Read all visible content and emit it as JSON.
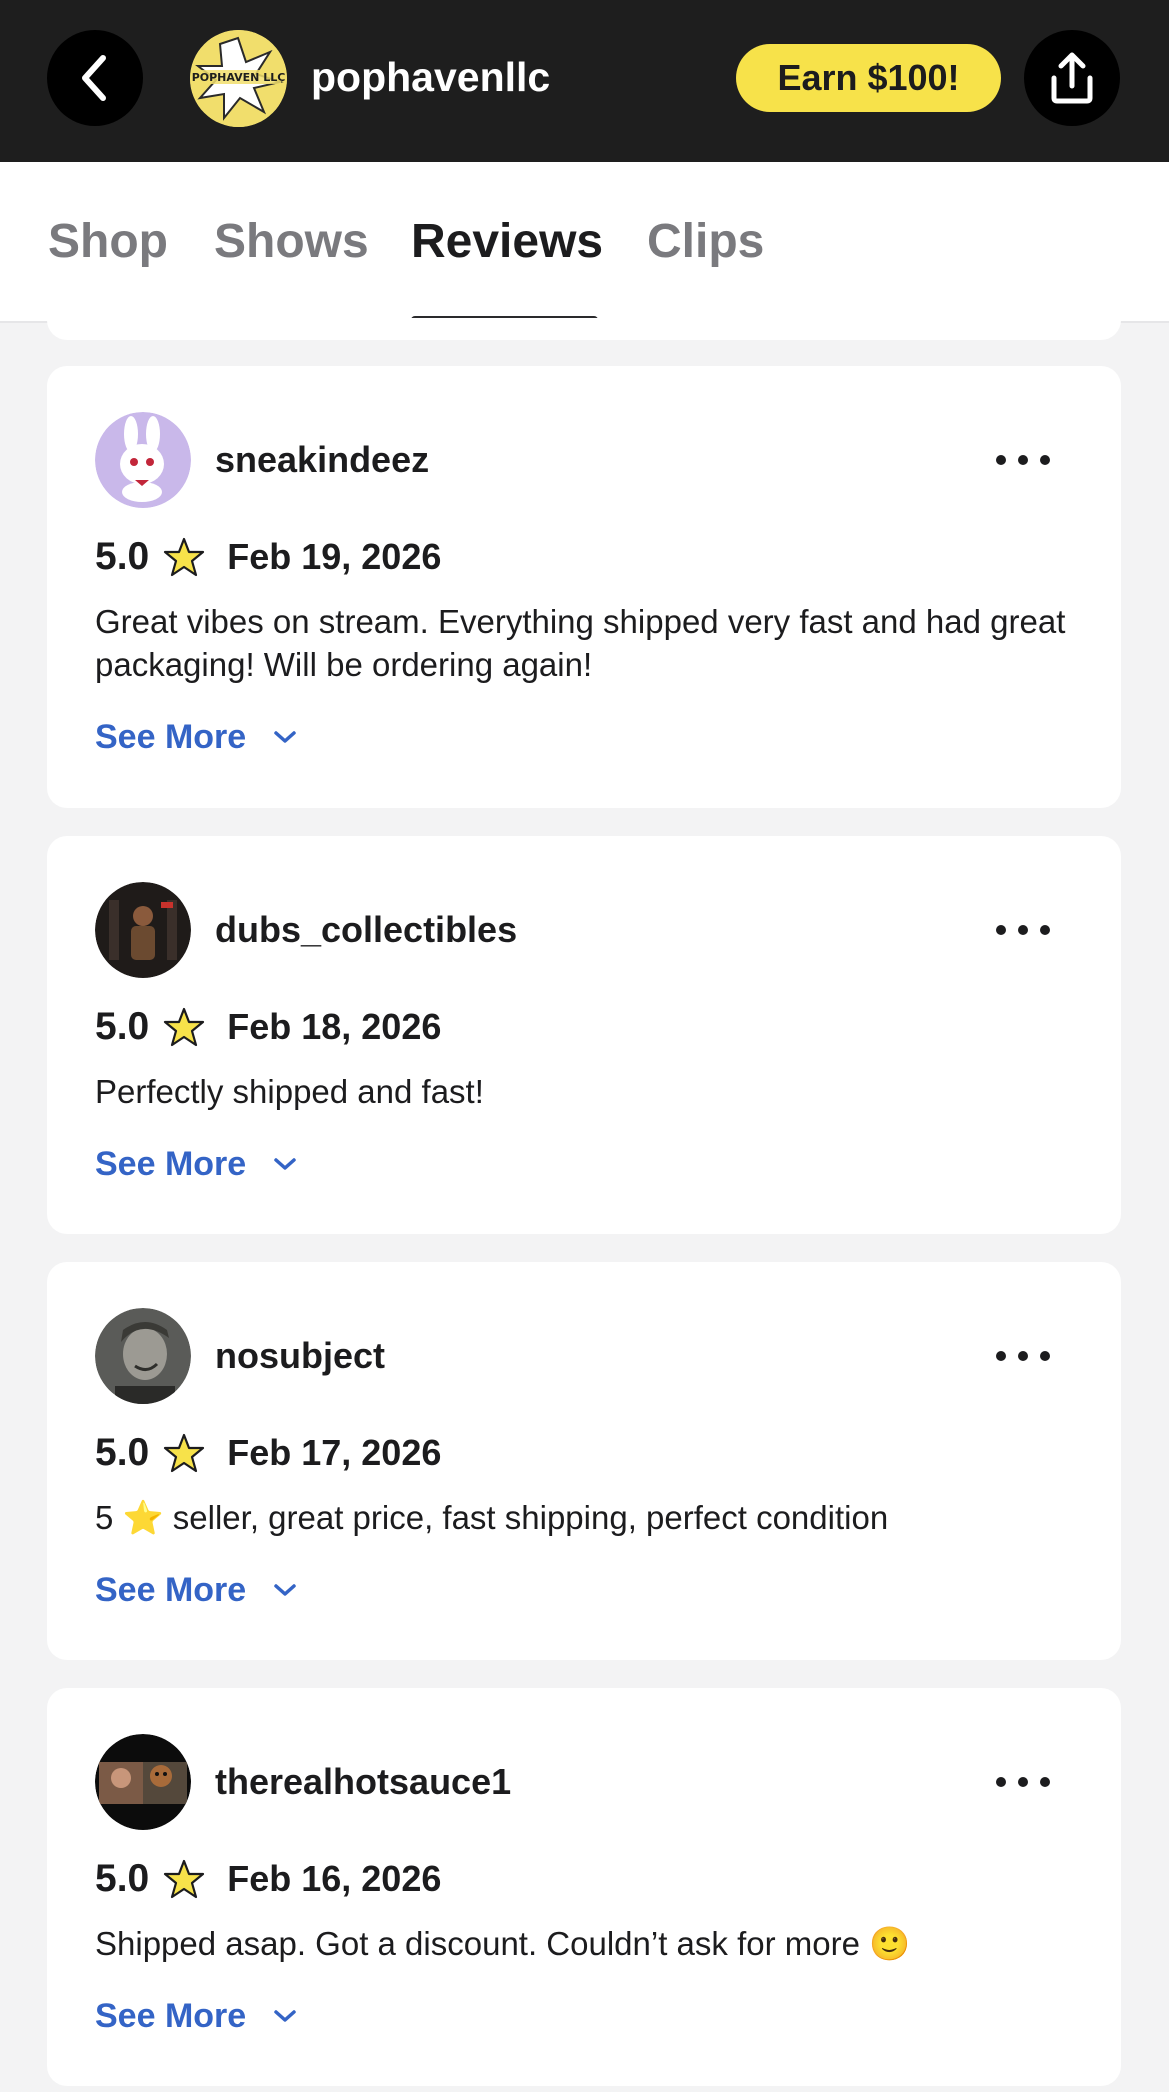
{
  "header": {
    "shop_name": "pophavenllc",
    "avatar_logo_text": "POPHAVEN LLC",
    "earn_label": "Earn $100!"
  },
  "tabs": [
    {
      "label": "Shop",
      "active": false
    },
    {
      "label": "Shows",
      "active": false
    },
    {
      "label": "Reviews",
      "active": true
    },
    {
      "label": "Clips",
      "active": false
    }
  ],
  "reviews": [
    {
      "username": "sneakindeez",
      "rating": "5.0",
      "date": "Feb 19, 2026",
      "text": "Great vibes on stream. Everything shipped very fast and had great packaging! Will be ordering again!",
      "see_more": "See More"
    },
    {
      "username": "dubs_collectibles",
      "rating": "5.0",
      "date": "Feb 18, 2026",
      "text": "Perfectly shipped and fast!",
      "see_more": "See More"
    },
    {
      "username": "nosubject",
      "rating": "5.0",
      "date": "Feb 17, 2026",
      "text": "5 ⭐ seller, great price, fast shipping, perfect condition",
      "see_more": "See More"
    },
    {
      "username": "therealhotsauce1",
      "rating": "5.0",
      "date": "Feb 16, 2026",
      "text": "Shipped asap. Got a discount. Couldn’t ask for more 🙂",
      "see_more": "See More"
    }
  ],
  "colors": {
    "header_bg": "#1e1e1e",
    "earn_button": "#f7e24a",
    "link_blue": "#3464c6",
    "star_yellow": "#f7e24a"
  },
  "icons": {
    "back": "chevron-left-icon",
    "share": "share-icon",
    "more": "more-dots-icon",
    "star": "star-outline-icon",
    "see_more": "chevron-down-icon"
  }
}
